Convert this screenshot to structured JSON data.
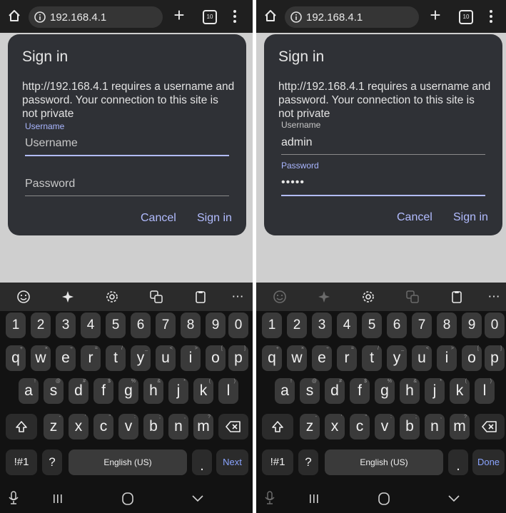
{
  "panels": [
    {
      "url": "192.168.4.1",
      "tab_count": "10",
      "dialog": {
        "title": "Sign in",
        "message": "http://192.168.4.1 requires a username and password. Your connection to this site is not private",
        "username_label": "Username",
        "username_value": "",
        "username_placeholder": "Username",
        "password_label": "",
        "password_value": "",
        "password_placeholder": "Password",
        "cancel": "Cancel",
        "signin": "Sign in"
      },
      "keyboard": {
        "numbers": [
          "1",
          "2",
          "3",
          "4",
          "5",
          "6",
          "7",
          "8",
          "9",
          "0"
        ],
        "row1": [
          "q",
          "w",
          "e",
          "r",
          "t",
          "y",
          "u",
          "i",
          "o",
          "p"
        ],
        "row1_sup": [
          "+",
          "×",
          "÷",
          "=",
          "/",
          "_",
          "<",
          ">",
          "[",
          "]"
        ],
        "row2": [
          "a",
          "s",
          "d",
          "f",
          "g",
          "h",
          "j",
          "k",
          "l"
        ],
        "row2_sup": [
          "!",
          "@",
          "#",
          "$",
          "%",
          "&",
          "*",
          "(",
          ")"
        ],
        "row3": [
          "z",
          "x",
          "c",
          "v",
          "b",
          "n",
          "m"
        ],
        "row3_sup": [
          "-",
          "'",
          "\"",
          ":",
          ";",
          ",",
          "?"
        ],
        "symbols_key": "!#1",
        "question_key": "?",
        "space_label": "English (US)",
        "period_key": ".",
        "action_key": "Next"
      }
    },
    {
      "url": "192.168.4.1",
      "tab_count": "10",
      "dialog": {
        "title": "Sign in",
        "message": "http://192.168.4.1 requires a username and password. Your connection to this site is not private",
        "username_label": "Username",
        "username_value": "admin",
        "username_placeholder": "",
        "password_label": "Password",
        "password_value": "•••••",
        "password_placeholder": "",
        "cancel": "Cancel",
        "signin": "Sign in"
      },
      "keyboard": {
        "numbers": [
          "1",
          "2",
          "3",
          "4",
          "5",
          "6",
          "7",
          "8",
          "9",
          "0"
        ],
        "row1": [
          "q",
          "w",
          "e",
          "r",
          "t",
          "y",
          "u",
          "i",
          "o",
          "p"
        ],
        "row1_sup": [
          "+",
          "×",
          "÷",
          "=",
          "/",
          "_",
          "<",
          ">",
          "[",
          "]"
        ],
        "row2": [
          "a",
          "s",
          "d",
          "f",
          "g",
          "h",
          "j",
          "k",
          "l"
        ],
        "row2_sup": [
          "!",
          "@",
          "#",
          "$",
          "%",
          "&",
          "*",
          "(",
          ")"
        ],
        "row3": [
          "z",
          "x",
          "c",
          "v",
          "b",
          "n",
          "m"
        ],
        "row3_sup": [
          "-",
          "'",
          "\"",
          ":",
          ";",
          ",",
          "?"
        ],
        "symbols_key": "!#1",
        "question_key": "?",
        "space_label": "English (US)",
        "period_key": ".",
        "action_key": "Done"
      }
    }
  ],
  "icons": {
    "home": "home-icon",
    "info": "info-icon",
    "new_tab": "plus-icon",
    "tabs": "tab-switcher-icon",
    "menu": "overflow-menu-icon",
    "emoji": "emoji-icon",
    "ai": "sparkle-icon",
    "settings": "gear-icon",
    "translate": "translate-icon",
    "clipboard": "clipboard-icon",
    "more": "more-icon",
    "shift": "shift-icon",
    "backspace": "backspace-icon",
    "mic": "mic-icon",
    "recents": "recents-icon",
    "home_nav": "home-nav-icon",
    "back": "back-chevron-icon"
  },
  "colors": {
    "accent": "#b2bcff",
    "dialog_bg": "#2f3136",
    "keyboard_bg": "#121212",
    "key_bg": "#3a3a3a"
  }
}
